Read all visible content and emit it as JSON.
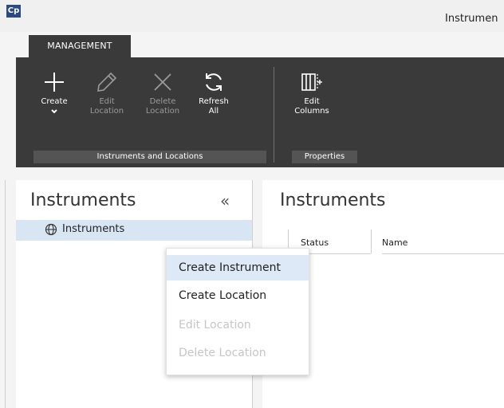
{
  "app": {
    "logo_text": "Cp",
    "window_title": "Instrumen"
  },
  "ribbon": {
    "tab_label": "MANAGEMENT",
    "buttons": {
      "create": {
        "label": "Create",
        "icon": "plus-icon",
        "enabled": true
      },
      "edit_location": {
        "label_1": "Edit",
        "label_2": "Location",
        "icon": "pencil-icon",
        "enabled": false
      },
      "delete_location": {
        "label_1": "Delete",
        "label_2": "Location",
        "icon": "x-icon",
        "enabled": false
      },
      "refresh_all": {
        "label_1": "Refresh",
        "label_2": "All",
        "icon": "refresh-icon",
        "enabled": true
      },
      "edit_columns": {
        "label_1": "Edit",
        "label_2": "Columns",
        "icon": "columns-icon",
        "enabled": true
      }
    },
    "groups": {
      "instruments_and_locations": "Instruments and Locations",
      "properties": "Properties"
    }
  },
  "left_pane": {
    "title": "Instruments",
    "collapse_glyph": "«",
    "tree": [
      {
        "label": "Instruments",
        "icon": "globe-icon",
        "selected": true
      }
    ]
  },
  "right_pane": {
    "title": "Instruments",
    "columns": [
      "Status",
      "Name"
    ]
  },
  "context_menu": {
    "items": [
      {
        "label": "Create Instrument",
        "enabled": true,
        "highlighted": true
      },
      {
        "label": "Create Location",
        "enabled": true,
        "highlighted": false
      },
      {
        "label": "Edit Location",
        "enabled": false,
        "highlighted": false
      },
      {
        "label": "Delete Location",
        "enabled": false,
        "highlighted": false
      }
    ]
  },
  "colors": {
    "ribbon_bg": "#3a3a3a",
    "selection_bg": "#d8e6f3",
    "menu_highlight": "#dde9f6",
    "disabled_text": "#9a9a9a"
  }
}
